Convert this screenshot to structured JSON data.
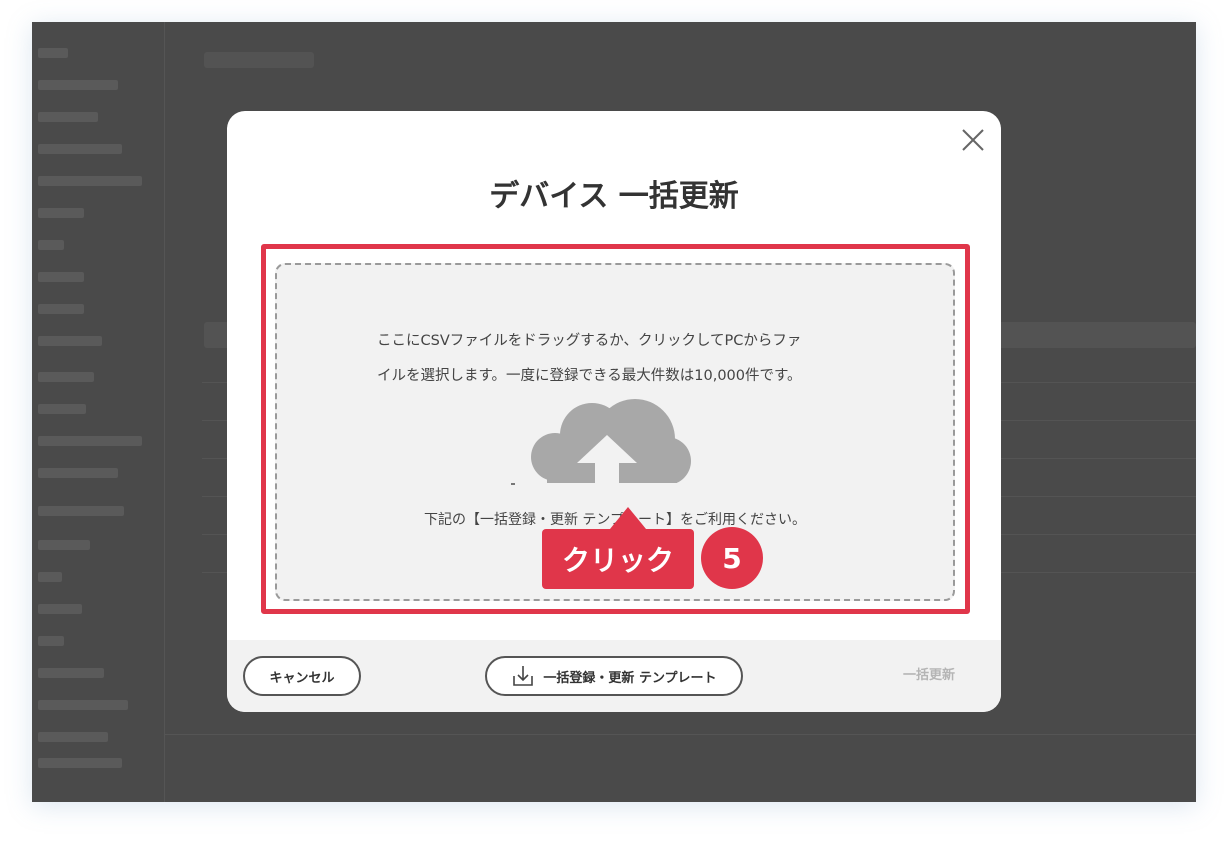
{
  "modal": {
    "title": "デバイス 一括更新",
    "dropzone": {
      "line1": "ここにCSVファイルをドラッグするか、クリックしてPCからファ",
      "line2": "イルを選択します。一度に登録できる最大件数は10,000件です。",
      "template_note": "下記の【一括登録・更新 テンプレート】をご利用ください。",
      "icon": "cloud-upload-icon"
    },
    "callout": {
      "label": "クリック",
      "step": "5"
    },
    "footer": {
      "cancel_label": "キャンセル",
      "template_label": "一括登録・更新 テンプレート",
      "update_label": "一括更新"
    },
    "close_icon": "close-icon"
  },
  "colors": {
    "accent": "#e0364a",
    "overlay": "#4a4a4a",
    "dropzone_bg": "#f2f2f2",
    "disabled_text": "#b5b5b5"
  }
}
